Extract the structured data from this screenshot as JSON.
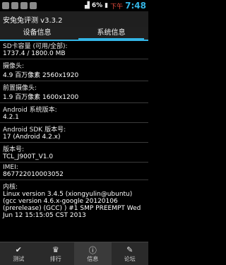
{
  "status_bar": {
    "battery": "6%",
    "ampm": "下午",
    "time": "7:48"
  },
  "app": {
    "title": "安兔兔评测 v3.3.2"
  },
  "tabs": [
    {
      "label": "设备信息"
    },
    {
      "label": "系统信息"
    }
  ],
  "system_info": {
    "sd_label": "SD卡容量 (可用/全部):",
    "sd_value": "1737.4 / 1800.0 MB",
    "camera_label": "摄像头:",
    "camera_value": "4.9 百万像素   2560x1920",
    "front_label": "前置摄像头:",
    "front_value": "1.9 百万像素   1600x1200",
    "android_version_label": "Android 系统版本:",
    "android_version_value": "4.2.1",
    "sdk_label": "Android SDK 版本号:",
    "sdk_value": "17  (Android 4.2.x)",
    "build_label": "版本号:",
    "build_value": "TCL_J900T_V1.0",
    "imei_label": "IMEI:",
    "imei_value": "867722010003052",
    "kernel_label": "内核:",
    "kernel_value": "Linux version 3.4.5 (xiongyulin@ubuntu) (gcc version 4.6.x-google 20120106 (prerelease) (GCC) ) #1 SMP PREEMPT Wed Jun 12 15:15:05 CST 2013"
  },
  "bottom_nav": [
    {
      "label": "测试",
      "icon": "check-icon"
    },
    {
      "label": "排行",
      "icon": "trophy-icon"
    },
    {
      "label": "信息",
      "icon": "info-icon"
    },
    {
      "label": "论坛",
      "icon": "forum-icon"
    }
  ]
}
